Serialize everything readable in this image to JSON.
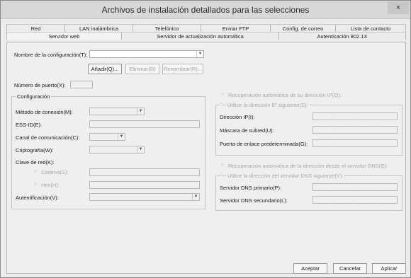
{
  "window": {
    "title": "Archivos de instalación detallados para las selecciones",
    "close": "×"
  },
  "tabs_row1": [
    "Red",
    "LAN inalámbrica",
    "Telefónico",
    "Enviar FTP",
    "Config. de correo",
    "Lista de contacto"
  ],
  "tabs_row2": [
    "Servidor web",
    "Servidor de actualización automática",
    "Autenticación 802.1X"
  ],
  "active_tab": "Servidor web",
  "config": {
    "name_label": "Nombre de la configuración(T):",
    "name_value": "",
    "add_label": "Añadir(Q)...",
    "delete_label": "Eliminar(D)",
    "rename_label": "Renombrar(R)...",
    "port_label": "Número de puerto(X):",
    "port_value": ""
  },
  "config_group": {
    "title": "Configuración",
    "method_label": "Método de conexión(M):",
    "essid_label": "ESS-ID(E):",
    "channel_label": "Canal de comunicación(C):",
    "crypto_label": "Criptografía(W):",
    "netkey_label": "Clave de red(K):",
    "string_label": "Cadena(S):",
    "hex_label": "Hex(H):",
    "auth_label": "Autentificación(V):"
  },
  "ip": {
    "auto_label": "Recuperación automática de su dirección IP(O):",
    "manual_label": "Utilice la dirección IP siguiente(S):",
    "address_label": "Dirección IP(I):",
    "mask_label": "Máscara de subred(U):",
    "gateway_label": "Puerta de enlace predeterminada(G):"
  },
  "dns": {
    "auto_label": "Recuperación automática de la dirección desde el servidor DNS(B):",
    "manual_label": "Utilice la dirección del servidor DNS siguiente(Y):",
    "primary_label": "Servidor DNS primario(P):",
    "secondary_label": "Servidor DNS secundario(L):"
  },
  "footer": {
    "ok_label": "Aceptar",
    "cancel_label": "Cancelar",
    "apply_label": "Aplicar"
  },
  "icons": {
    "dropdown": "chevron-down-icon",
    "radio": "radio-icon"
  }
}
